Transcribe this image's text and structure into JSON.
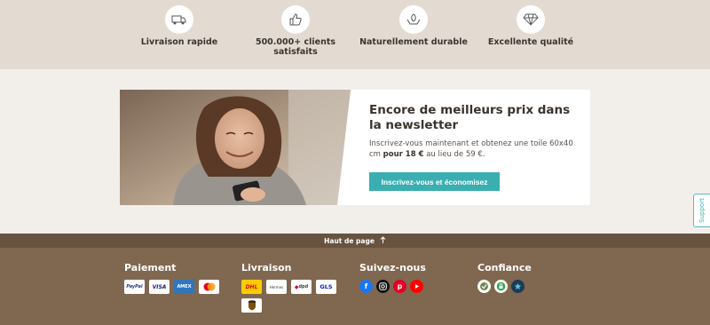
{
  "features": [
    {
      "label": "Livraison rapide",
      "icon": "delivery-truck-icon"
    },
    {
      "label": "500.000+ clients satisfaits",
      "icon": "thumbs-up-icon"
    },
    {
      "label": "Naturellement durable",
      "icon": "hands-leaf-icon"
    },
    {
      "label": "Excellente qualité",
      "icon": "diamond-icon"
    }
  ],
  "newsletter": {
    "title": "Encore de meilleurs prix dans la newsletter",
    "text_before": "Inscrivez-vous maintenant et obtenez une toile 60x40 cm ",
    "text_bold": "pour 18 €",
    "text_after": " au lieu de 59 €.",
    "button": "Inscrivez-vous et économisez"
  },
  "support": {
    "label": "Support"
  },
  "back_to_top": {
    "label": "Haut de page",
    "icon": "arrow-up-icon"
  },
  "footer": {
    "payment": {
      "title": "Paiement",
      "methods": [
        "PayPal",
        "VISA",
        "AMEX",
        "Mastercard"
      ]
    },
    "shipping": {
      "title": "Livraison",
      "carriers": [
        "DHL",
        "Hermes",
        "dpd",
        "GLS",
        "UPS"
      ]
    },
    "social": {
      "title": "Suivez-nous",
      "networks": [
        "facebook-icon",
        "instagram-icon",
        "pinterest-icon",
        "youtube-icon"
      ]
    },
    "trust": {
      "title": "Confiance",
      "badges": [
        "trusted-shops-icon",
        "secure-lock-icon",
        "star-rating-icon"
      ]
    }
  },
  "colors": {
    "accent": "#3aaeb0",
    "footer": "#80674f",
    "top_bar": "#67533f",
    "features_bg": "#e3dbd2"
  }
}
